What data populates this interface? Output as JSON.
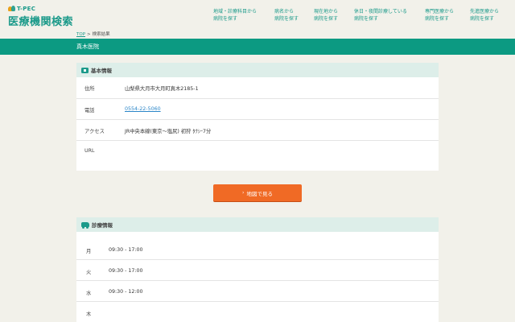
{
  "header": {
    "brand_small": "T-PEC",
    "site_title": "医療機関検索",
    "nav": [
      {
        "line1": "地域・診療科目から",
        "line2": "病院を探す"
      },
      {
        "line1": "病名から",
        "line2": "病院を探す"
      },
      {
        "line1": "現在地から",
        "line2": "病院を探す"
      },
      {
        "line1": "休日・夜間診療している",
        "line2": "病院を探す"
      },
      {
        "line1": "専門医療から",
        "line2": "病院を探す"
      },
      {
        "line1": "先進医療から",
        "line2": "病院を探す"
      }
    ]
  },
  "breadcrumb": {
    "top": "TOP",
    "sep": ">",
    "current": "検索結果"
  },
  "page_title": "真木医院",
  "basic_info": {
    "heading": "基本情報",
    "rows": [
      {
        "label": "住所",
        "value": "山梨県大月市大月町真木2185-1"
      },
      {
        "label": "電話",
        "value": "0554-22-5060"
      },
      {
        "label": "アクセス",
        "value": "JR中央本線(東京〜塩尻) 初狩 ﾀｸｼｰ7分"
      },
      {
        "label": "URL",
        "value": ""
      }
    ]
  },
  "map_button": {
    "label": "地図で見る",
    "chevron": "›"
  },
  "clinic_info": {
    "heading": "診療情報",
    "rows": [
      {
        "day": "月",
        "hours": "09:30 - 17:00"
      },
      {
        "day": "火",
        "hours": "09:30 - 17:00"
      },
      {
        "day": "水",
        "hours": "09:30 - 12:00"
      },
      {
        "day": "木",
        "hours": ""
      }
    ]
  },
  "colors": {
    "accent": "#0c9a82",
    "button": "#f06a25",
    "link": "#2b86c8"
  }
}
